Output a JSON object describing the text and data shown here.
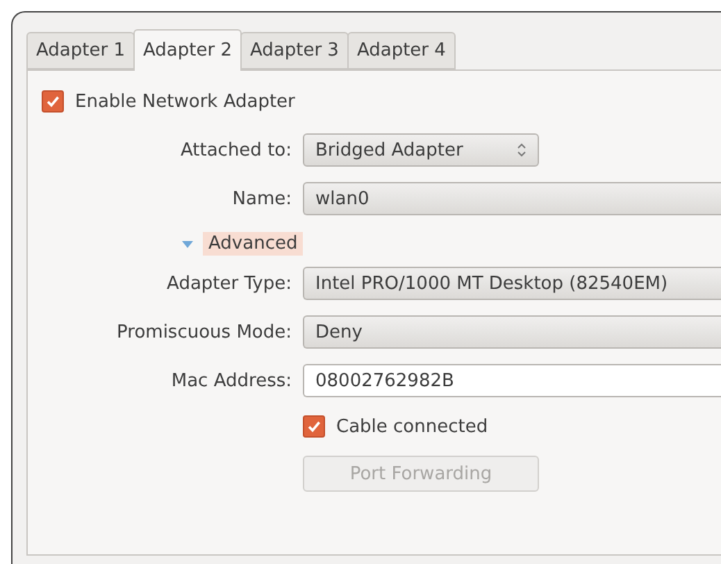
{
  "tabs": [
    {
      "label": "Adapter 1",
      "selected": false
    },
    {
      "label": "Adapter 2",
      "selected": true
    },
    {
      "label": "Adapter 3",
      "selected": false
    },
    {
      "label": "Adapter 4",
      "selected": false
    }
  ],
  "enable_adapter": {
    "label": "Enable Network Adapter",
    "checked": true
  },
  "fields": [
    {
      "kind": "spin",
      "label": "Attached to:",
      "value": "Bridged Adapter"
    },
    {
      "kind": "combo",
      "label": "Name:",
      "value": "wlan0"
    }
  ],
  "advanced": {
    "label": "Advanced",
    "expanded": true,
    "fields": [
      {
        "kind": "combo",
        "label": "Adapter Type:",
        "value": "Intel PRO/1000 MT Desktop (82540EM)"
      },
      {
        "kind": "combo",
        "label": "Promiscuous Mode:",
        "value": "Deny"
      },
      {
        "kind": "text",
        "label": "Mac Address:",
        "value": "08002762982B"
      }
    ],
    "cable_connected": {
      "label": "Cable connected",
      "checked": true
    },
    "port_forwarding": {
      "label": "Port Forwarding",
      "disabled": true
    }
  }
}
